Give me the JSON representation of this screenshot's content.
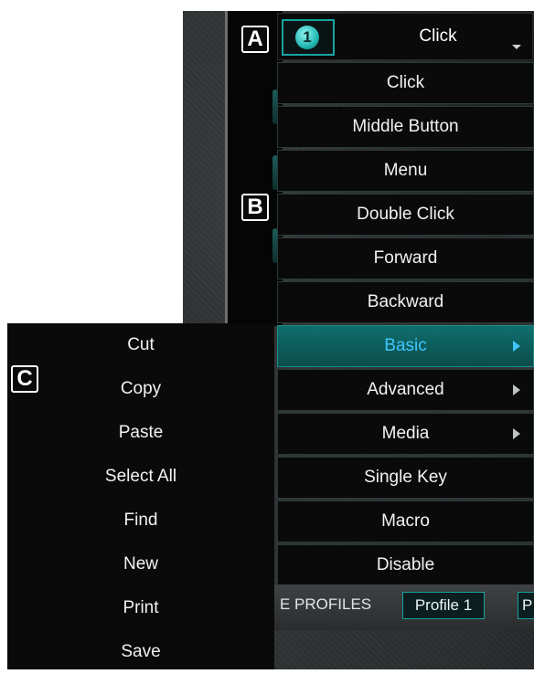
{
  "labels": {
    "a": "A",
    "b": "B",
    "c": "C"
  },
  "selector": {
    "badge": "1",
    "value": "Click"
  },
  "menu": {
    "items": [
      {
        "label": "Click"
      },
      {
        "label": "Middle Button"
      },
      {
        "label": "Menu"
      },
      {
        "label": "Double Click"
      },
      {
        "label": "Forward"
      },
      {
        "label": "Backward"
      },
      {
        "label": "Basic",
        "active": true,
        "has_submenu": true
      },
      {
        "label": "Advanced",
        "has_submenu": true
      },
      {
        "label": "Media",
        "has_submenu": true
      },
      {
        "label": "Single Key"
      },
      {
        "label": "Macro"
      },
      {
        "label": "Disable"
      }
    ]
  },
  "submenu": {
    "items": [
      {
        "label": "Cut"
      },
      {
        "label": "Copy"
      },
      {
        "label": "Paste"
      },
      {
        "label": "Select All"
      },
      {
        "label": "Find"
      },
      {
        "label": "New"
      },
      {
        "label": "Print"
      },
      {
        "label": "Save"
      }
    ]
  },
  "profiles": {
    "label": "E PROFILES",
    "active_tab": "Profile 1",
    "next_tab": "P"
  },
  "colors": {
    "accent": "#17a3a0",
    "active_text": "#3ec6ff",
    "menu_bg": "#0a0a0a"
  }
}
